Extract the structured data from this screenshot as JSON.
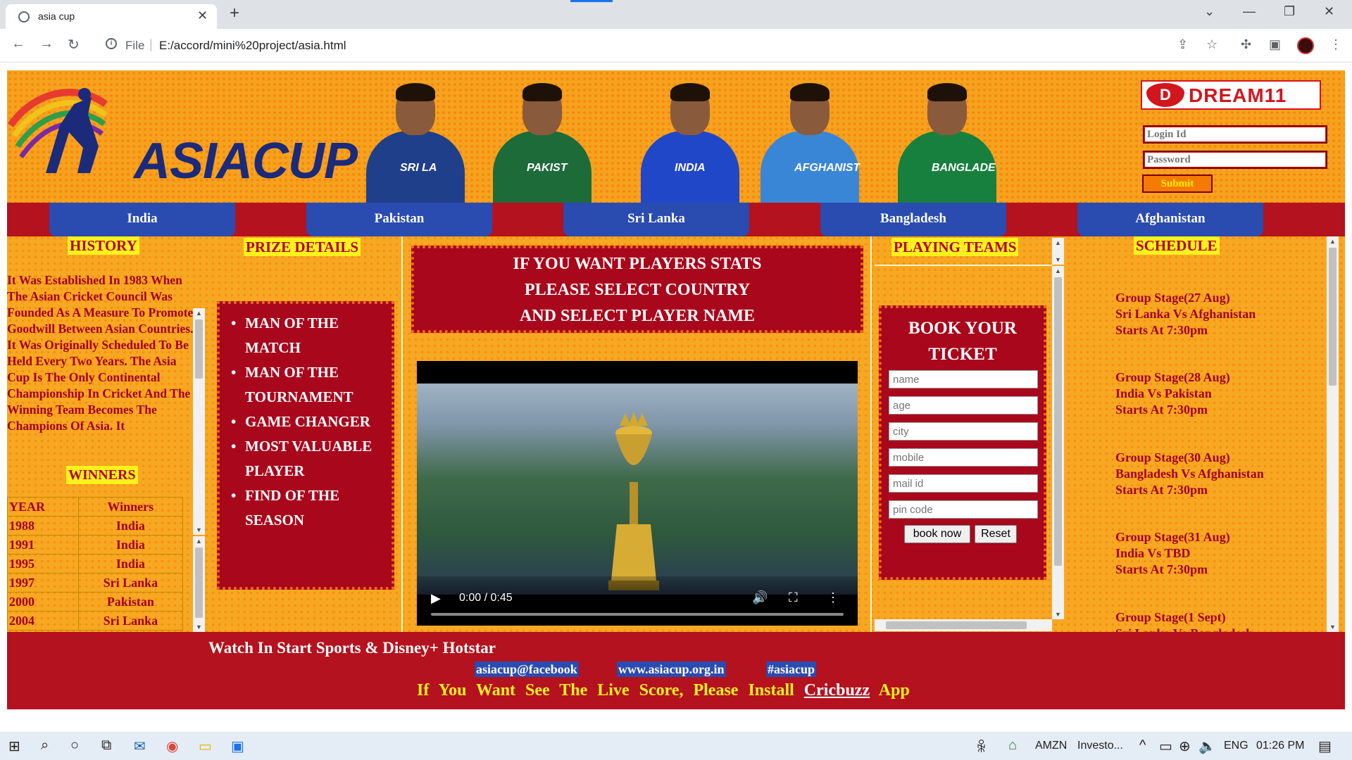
{
  "browser": {
    "tab_title": "asia cup",
    "address_scheme": "File",
    "address_url": "E:/accord/mini%20project/asia.html"
  },
  "header": {
    "logo_text": "ASIACUP",
    "players": [
      {
        "jersey": "SRI LA",
        "color": "#1f3f8a"
      },
      {
        "jersey": "PAKIST",
        "color": "#1e6b3a"
      },
      {
        "jersey": "INDIA",
        "color": "#2047c8"
      },
      {
        "jersey": "AFGHANIST",
        "color": "#3a86d6"
      },
      {
        "jersey": "BANGLADE",
        "color": "#17803f"
      }
    ],
    "sponsor": "DREAM11",
    "login_placeholder": "Login Id",
    "password_placeholder": "Password",
    "submit_label": "Submit"
  },
  "nav": [
    "India",
    "Pakistan",
    "Sri Lanka",
    "Bangladesh",
    "Afghanistan"
  ],
  "history": {
    "title": "HISTORY",
    "text": "It Was Established In 1983 When The Asian Cricket Council Was Founded As A Measure To Promote Goodwill Between Asian Countries. It Was Originally Scheduled To Be Held Every Two Years. The Asia Cup Is The Only Continental Championship In Cricket And The Winning Team Becomes The Champions Of Asia. It"
  },
  "winners": {
    "title": "WINNERS",
    "headers": [
      "YEAR",
      "Winners"
    ],
    "rows": [
      [
        "1988",
        "India"
      ],
      [
        "1991",
        "India"
      ],
      [
        "1995",
        "India"
      ],
      [
        "1997",
        "Sri Lanka"
      ],
      [
        "2000",
        "Pakistan"
      ],
      [
        "2004",
        "Sri Lanka"
      ]
    ]
  },
  "prize": {
    "title": "PRIZE DETAILS",
    "items": [
      "MAN OF THE MATCH",
      "MAN OF THE TOURNAMENT",
      "GAME CHANGER",
      "MOST VALUABLE PLAYER",
      "FIND OF THE SEASON"
    ]
  },
  "stats_banner": {
    "line1": "IF YOU WANT PLAYERS STATS",
    "line2": "PLEASE SELECT COUNTRY",
    "line3": "AND SELECT PLAYER NAME"
  },
  "video": {
    "time": "0:00 / 0:45"
  },
  "playing_teams": {
    "title": "PLAYING TEAMS"
  },
  "booking": {
    "title_line1": "BOOK YOUR",
    "title_line2": "TICKET",
    "fields": [
      "name",
      "age",
      "city",
      "mobile",
      "mail id",
      "pin code"
    ],
    "book_label": "book now",
    "reset_label": "Reset"
  },
  "schedule": {
    "title": "SCHEDULE",
    "items": [
      {
        "stage": "Group Stage(27 Aug)",
        "match": "Sri Lanka Vs Afghanistan",
        "time": "Starts At 7:30pm"
      },
      {
        "stage": "Group Stage(28 Aug)",
        "match": "India Vs Pakistan",
        "time": "Starts At 7:30pm"
      },
      {
        "stage": "Group Stage(30 Aug)",
        "match": "Bangladesh Vs Afghanistan",
        "time": "Starts At 7:30pm"
      },
      {
        "stage": "Group Stage(31 Aug)",
        "match": "India Vs TBD",
        "time": "Starts At 7:30pm"
      },
      {
        "stage": "Group Stage(1 Sept)",
        "match": "Sri Lanka Vs Bangladesh",
        "time": ""
      }
    ]
  },
  "footer": {
    "watch": "Watch In Start Sports & Disney+ Hotstar",
    "links": [
      "asiacup@facebook",
      "www.asiacup.org.in",
      "#asiacup"
    ],
    "live_prefix": "If You Want See The Live Score, Please Install",
    "live_app": "Cricbuzz",
    "live_suffix": "App"
  },
  "taskbar": {
    "stock_label": "AMZN",
    "stock_text": "Investo...",
    "lang": "ENG",
    "time": "01:26 PM"
  }
}
